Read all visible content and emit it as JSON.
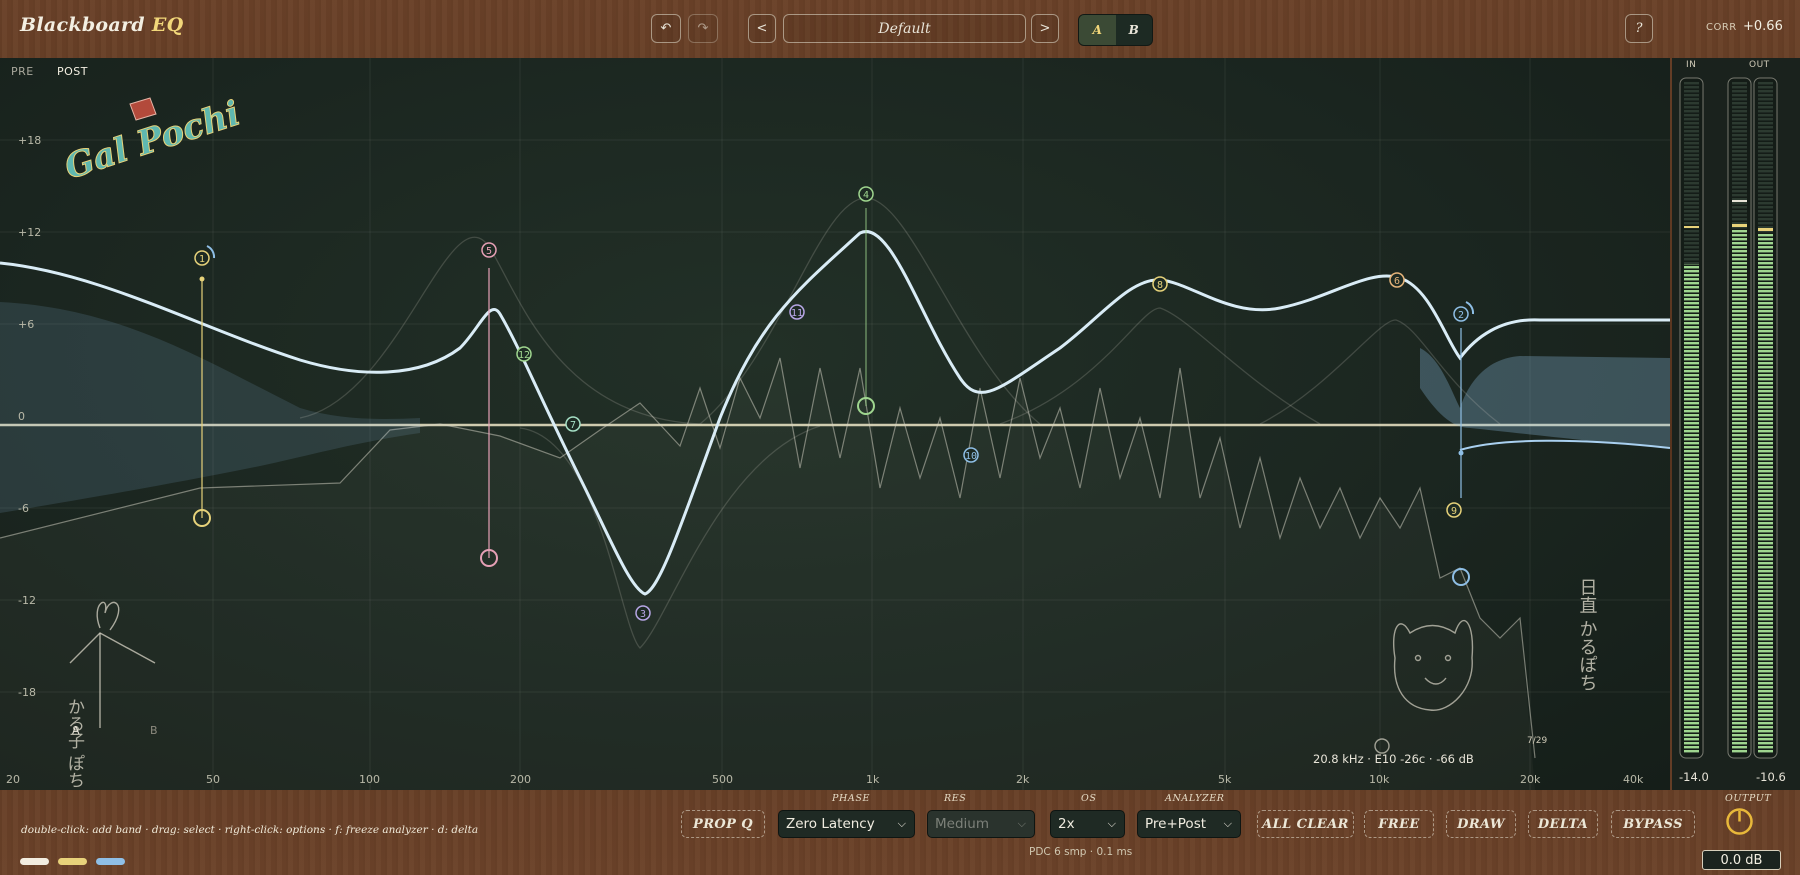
{
  "app": {
    "name": "Blackboard",
    "name_accent": "EQ"
  },
  "header": {
    "undo_label": "↶",
    "redo_label": "↷",
    "prev_label": "<",
    "next_label": ">",
    "preset": "Default",
    "a_label": "A",
    "b_label": "B",
    "help_label": "?",
    "corr_label": "CORR",
    "corr_value": "+0.66"
  },
  "display": {
    "pre_label": "PRE",
    "post_label": "POST",
    "db_labels": [
      "+18",
      "+12",
      "+6",
      "0",
      "-6",
      "-12",
      "-18"
    ],
    "freq_labels": [
      "20",
      "50",
      "100",
      "200",
      "500",
      "1k",
      "2k",
      "5k",
      "10k",
      "20k",
      "40k"
    ],
    "readout": "20.8 kHz · E10 -26c · -66 dB",
    "bands": [
      {
        "n": "1",
        "color": "#e6d27a"
      },
      {
        "n": "2",
        "color": "#8fbfe6"
      },
      {
        "n": "3",
        "color": "#b7a6e6"
      },
      {
        "n": "4",
        "color": "#9fd68f"
      },
      {
        "n": "5",
        "color": "#e6a0b6"
      },
      {
        "n": "6",
        "color": "#e6b47a"
      },
      {
        "n": "7",
        "color": "#a6e0c6"
      },
      {
        "n": "8",
        "color": "#e6d27a"
      },
      {
        "n": "9",
        "color": "#e6d27a"
      },
      {
        "n": "10",
        "color": "#8fbfe6"
      },
      {
        "n": "11",
        "color": "#b7a6e6"
      },
      {
        "n": "12",
        "color": "#9fd68f"
      }
    ],
    "doodles": {
      "logo_text": "Gal Pochi",
      "left_text": "かる子 ぽち",
      "right_text": "日直 かるぽち",
      "left_a": "A",
      "left_b": "B",
      "date": "7/29"
    }
  },
  "meters": {
    "in_label": "IN",
    "out_label": "OUT",
    "in_value": "-14.0",
    "out_value": "-10.6"
  },
  "bottom": {
    "hint": "double-click: add band · drag: select · right-click: options · f: freeze analyzer · d: delta",
    "prop_q": "PROP Q",
    "phase_label": "PHASE",
    "phase_value": "Zero Latency",
    "res_label": "RES",
    "res_value": "Medium",
    "os_label": "OS",
    "os_value": "2x",
    "analyzer_label": "ANALYZER",
    "analyzer_value": "Pre+Post",
    "all_clear": "ALL CLEAR",
    "free": "FREE",
    "draw": "DRAW",
    "delta": "DELTA",
    "bypass": "BYPASS",
    "pdc": "PDC 6 smp · 0.1 ms",
    "output_label": "OUTPUT",
    "output_value": "0.0 dB",
    "swatch_colors": [
      "#f2ede0",
      "#e8d27a",
      "#8fbfe6"
    ]
  }
}
